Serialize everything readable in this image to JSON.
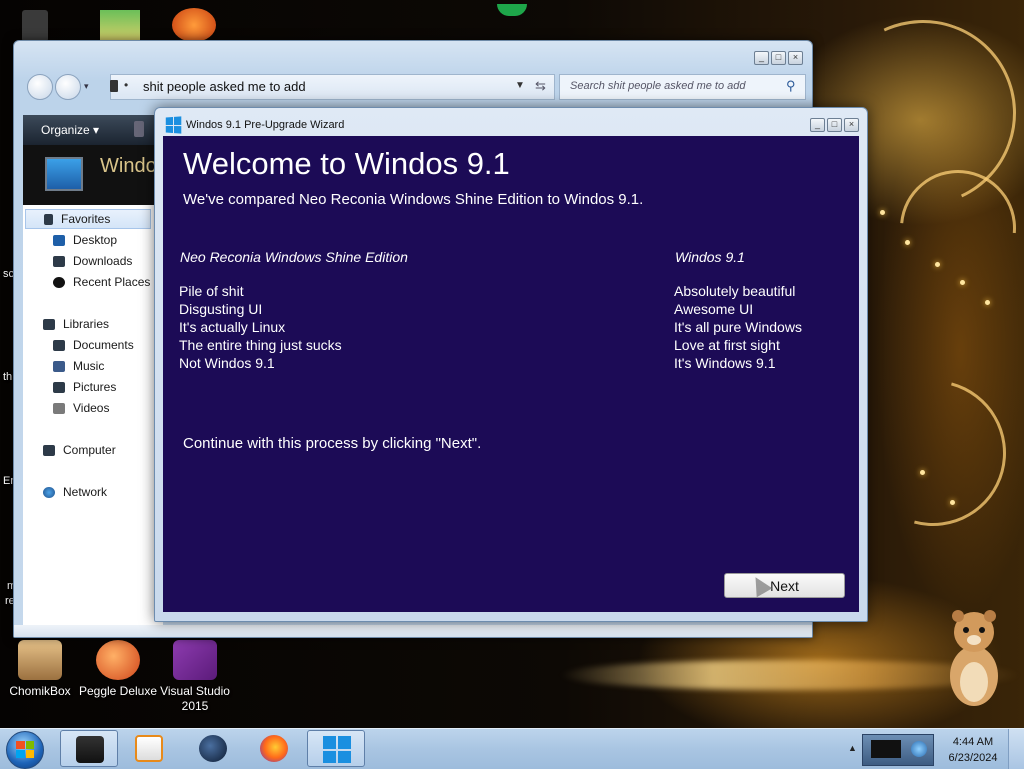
{
  "desktop": {
    "icons": [
      {
        "label": "ChomikBox",
        "color": "#c9a06a"
      },
      {
        "label": "Peggle Deluxe",
        "color": "#e6641e"
      },
      {
        "label": "Visual Studio\n2015",
        "label_line1": "Visual Studio",
        "label_line2": "2015",
        "color": "#68217a"
      }
    ],
    "partial_labels": [
      "sc",
      "th",
      "En",
      "m",
      "re"
    ]
  },
  "explorer": {
    "address_path": "shit people asked me to add",
    "search_placeholder": "Search shit people asked me to add",
    "toolbar_organize": "Organize",
    "header_title_partial": "Windo",
    "nav": {
      "favorites": "Favorites",
      "desktop": "Desktop",
      "downloads": "Downloads",
      "recent_places": "Recent Places",
      "libraries": "Libraries",
      "documents": "Documents",
      "music": "Music",
      "pictures": "Pictures",
      "videos": "Videos",
      "computer": "Computer",
      "network": "Network"
    }
  },
  "wizard": {
    "title": "Windos 9.1 Pre-Upgrade Wizard",
    "heading": "Welcome to Windos 9.1",
    "subtitle": "We've compared Neo Reconia Windows Shine Edition  to Windos 9.1.",
    "left_column": {
      "header": "Neo Reconia Windows Shine Edition",
      "items": [
        "Pile of shit",
        "Disgusting UI",
        "It's actually Linux",
        "The entire thing just sucks",
        "Not Windos 9.1"
      ]
    },
    "right_column": {
      "header": "Windos 9.1",
      "items": [
        "Absolutely beautiful",
        "Awesome UI",
        "It's all pure Windows",
        "Love at first sight",
        "It's Windows 9.1"
      ]
    },
    "instruction": "Continue with this process by clicking \"Next\".",
    "next_label": "Next"
  },
  "taskbar": {
    "time": "4:44 AM",
    "date": "6/23/2024"
  },
  "colors": {
    "wizard_background": "#1c0b56",
    "taskbar": "#a9c5e2"
  }
}
